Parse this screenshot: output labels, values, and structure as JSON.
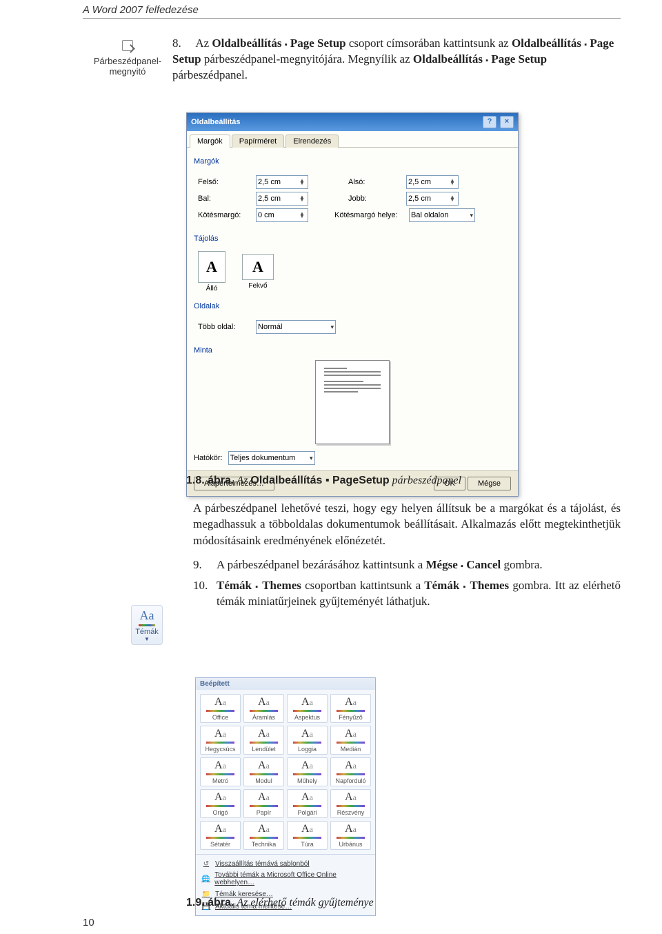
{
  "header": {
    "title": "A Word 2007 felfedezése"
  },
  "footer": {
    "page": "10"
  },
  "sidebar": {
    "launcher_label": "Párbeszédpanel-megnyitó"
  },
  "intro": {
    "num": "8.",
    "t1": "Az ",
    "b1": "Oldalbeállítás",
    "b2": "Page Setup",
    "t2": " csoport címsorában kattintsunk az ",
    "b3": "Oldalbeállítás",
    "b4": "Page Setup",
    "t3": " párbeszédpanel-megnyitójára. ",
    "t4": "Megnyílik az ",
    "b5": "Oldalbeállítás",
    "b6": "Page Setup",
    "t5": " párbeszédpanel."
  },
  "dialog": {
    "title": "Oldalbeállítás",
    "help_glyph": "?",
    "close_glyph": "×",
    "tabs": [
      "Margók",
      "Papírméret",
      "Elrendezés"
    ],
    "sections": {
      "margins": "Margók",
      "orientation": "Tájolás",
      "pages": "Oldalak",
      "preview": "Minta"
    },
    "fields": {
      "top": {
        "label": "Felső:",
        "value": "2,5 cm"
      },
      "bottom": {
        "label": "Alsó:",
        "value": "2,5 cm"
      },
      "left": {
        "label": "Bal:",
        "value": "2,5 cm"
      },
      "right": {
        "label": "Jobb:",
        "value": "2,5 cm"
      },
      "gutter": {
        "label": "Kötésmargó:",
        "value": "0 cm"
      },
      "gutter_pos": {
        "label": "Kötésmargó helye:",
        "value": "Bal oldalon"
      },
      "multipage": {
        "label": "Több oldal:",
        "value": "Normál"
      },
      "applyto": {
        "label": "Hatókör:",
        "value": "Teljes dokumentum"
      }
    },
    "orientation": {
      "portrait": "Álló",
      "landscape": "Fekvő"
    },
    "buttons": {
      "default": "Alapértelmezés…",
      "ok": "OK",
      "cancel": "Mégse"
    }
  },
  "caption1": {
    "num": "1.8. ábra.",
    "t1": "Az",
    "b1": "Oldalbeállítás ▪ PageSetup",
    "t2": "párbeszédpanel"
  },
  "body": {
    "p1": "A párbeszédpanel lehetővé teszi, hogy egy helyen állítsuk be a margókat és a tájolást, és megadhassuk a többoldalas dokumentumok beállításait. Alkalmazás előtt megtekinthetjük módosításaink eredményének előnézetét.",
    "step9": {
      "num": "9.",
      "t1": "A párbeszédpanel bezárásához kattintsunk a ",
      "b1": "Mégse",
      "b2": "Cancel",
      "t2": " gombra."
    },
    "step10": {
      "num": "10.",
      "b1": "Témák",
      "b2": "Themes",
      "t1": " csoportban kattintsunk a ",
      "b3": "Témák",
      "b4": "Themes",
      "t2": " gombra. ",
      "t3": "Itt az elérhető témák miniatűrjeinek gyűjteményét láthatjuk."
    }
  },
  "themes_button": {
    "label": "Témák"
  },
  "gallery": {
    "header": "Beépített",
    "themes": [
      "Office",
      "Áramlás",
      "Aspektus",
      "Fényűző",
      "Hegycsúcs",
      "Lendület",
      "Loggia",
      "Medián",
      "Metró",
      "Modul",
      "Műhely",
      "Napforduló",
      "Origó",
      "Papír",
      "Polgári",
      "Részvény",
      "Sétatér",
      "Technika",
      "Túra",
      "Urbánus"
    ],
    "links": [
      "Visszaállítás témává sablonból",
      "További témák a Microsoft Office Online webhelyen…",
      "Témák keresése…",
      "Aktuális téma mentése…"
    ]
  },
  "caption2": {
    "num": "1.9. ábra.",
    "text": " Az elérhető témák gyűjteménye"
  }
}
